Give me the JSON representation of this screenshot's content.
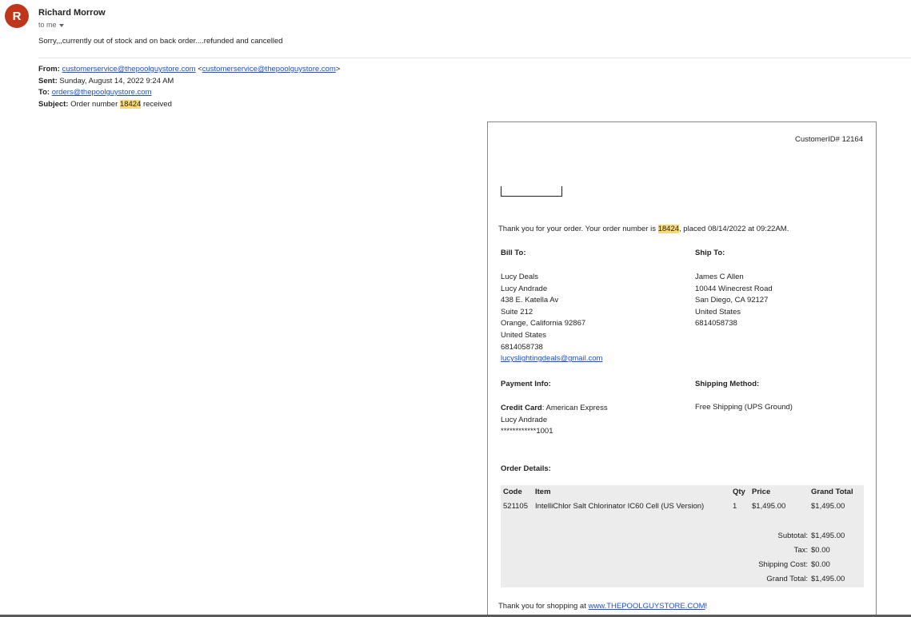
{
  "sender": {
    "avatar_letter": "R",
    "name": "Richard Morrow",
    "to_line": "to me",
    "reply": "Sorry,,,currently out of stock and on back order....refunded and cancelled"
  },
  "forwarded": {
    "from_label": "From:",
    "from_email": "customerservice@thepoolguystore.com",
    "from_email2": "customerservice@thepoolguystore.com",
    "sent_label": "Sent:",
    "sent_value": "Sunday, August 14, 2022 9:24 AM",
    "to_label": "To:",
    "to_email": "orders@thepoolguystore.com",
    "subject_label": "Subject:",
    "subject_pre": "Order number",
    "subject_num": "18424",
    "subject_post": "received"
  },
  "order": {
    "customer_id": "CustomerID# 12164",
    "thanks_pre": "Thank you for your order. Your order number is",
    "order_number": "18424",
    "thanks_post": ", placed 08/14/2022 at 09:22AM.",
    "bill_to": {
      "heading": "Bill To:",
      "lines": [
        "Lucy Deals",
        "Lucy Andrade",
        "438 E. Katella Av",
        "Suite 212",
        "Orange, California 92867",
        "United States",
        "6814058738"
      ],
      "email": "lucyslightingdeals@gmail.com"
    },
    "ship_to": {
      "heading": "Ship To:",
      "lines": [
        "James C Allen",
        "10044 Winecrest Road",
        "San Diego, CA 92127",
        "United States",
        "6814058738"
      ]
    },
    "payment": {
      "heading": "Payment Info:",
      "card_label": "Credit Card",
      "card_value": ": American Express",
      "name": "Lucy Andrade",
      "number": "************1001"
    },
    "shipping_method": {
      "heading": "Shipping Method:",
      "value": "Free Shipping (UPS Ground)"
    },
    "details": {
      "heading": "Order Details:",
      "columns": {
        "code": "Code",
        "item": "Item",
        "qty": "Qty",
        "price": "Price",
        "total": "Grand Total"
      },
      "rows": [
        {
          "code": "521105",
          "item": "IntelliChlor Salt Chlorinator IC60 Cell (US Version)",
          "qty": "1",
          "price": "$1,495.00",
          "total": "$1,495.00"
        }
      ],
      "subtotal_label": "Subtotal:",
      "subtotal": "$1,495.00",
      "tax_label": "Tax:",
      "tax": "$0.00",
      "shipping_label": "Shipping Cost:",
      "shipping": "$0.00",
      "grand_label": "Grand Total:",
      "grand": "$1,495.00"
    },
    "footer_pre": "Thank you for shopping at",
    "footer_link": "www.THEPOOLGUYSTORE.COM",
    "footer_post": "!"
  }
}
